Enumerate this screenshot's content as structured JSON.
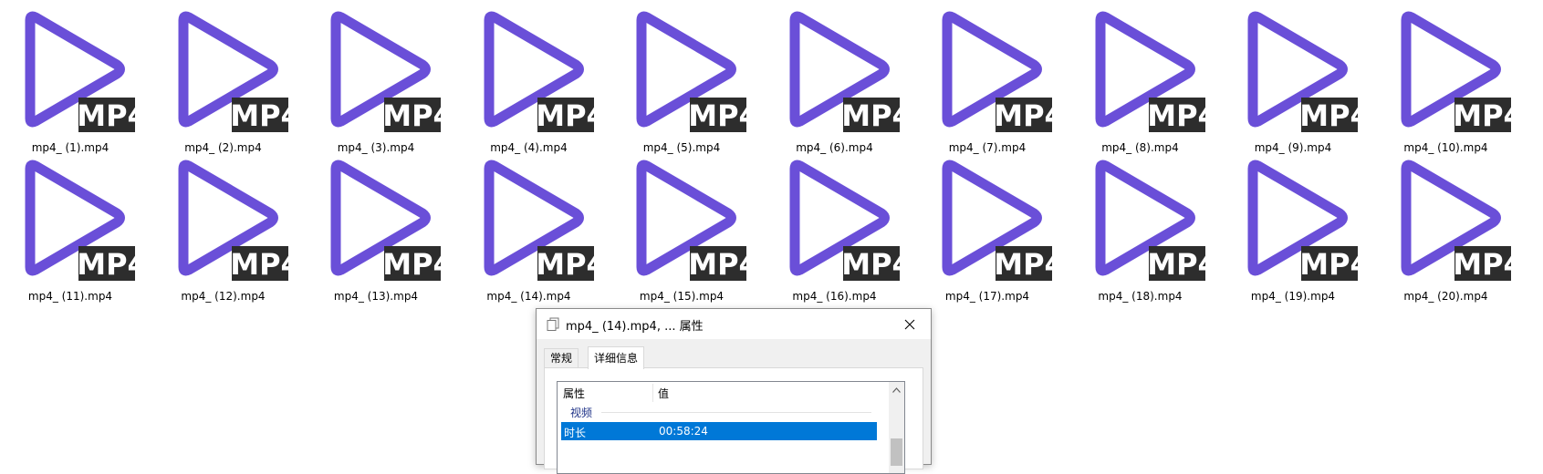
{
  "colors": {
    "play_purple": "#6a4fd8",
    "badge_bg": "#2d2d2d",
    "badge_text": "#ffffff",
    "selection": "#0078d7"
  },
  "files": [
    {
      "name": "mp4_ (1).mp4"
    },
    {
      "name": "mp4_ (2).mp4"
    },
    {
      "name": "mp4_ (3).mp4"
    },
    {
      "name": "mp4_ (4).mp4"
    },
    {
      "name": "mp4_ (5).mp4"
    },
    {
      "name": "mp4_ (6).mp4"
    },
    {
      "name": "mp4_ (7).mp4"
    },
    {
      "name": "mp4_ (8).mp4"
    },
    {
      "name": "mp4_ (9).mp4"
    },
    {
      "name": "mp4_ (10).mp4"
    },
    {
      "name": "mp4_ (11).mp4"
    },
    {
      "name": "mp4_ (12).mp4"
    },
    {
      "name": "mp4_ (13).mp4"
    },
    {
      "name": "mp4_ (14).mp4"
    },
    {
      "name": "mp4_ (15).mp4"
    },
    {
      "name": "mp4_ (16).mp4"
    },
    {
      "name": "mp4_ (17).mp4"
    },
    {
      "name": "mp4_ (18).mp4"
    },
    {
      "name": "mp4_ (19).mp4"
    },
    {
      "name": "mp4_ (20).mp4"
    }
  ],
  "badge_label": "MP4",
  "dialog": {
    "title": "mp4_ (14).mp4, ... 属性",
    "tabs": [
      {
        "label": "常规"
      },
      {
        "label": "详细信息"
      }
    ],
    "columns": {
      "property": "属性",
      "value": "值"
    },
    "group": "视频",
    "selected_row": {
      "property": "时长",
      "value": "00:58:24"
    }
  }
}
